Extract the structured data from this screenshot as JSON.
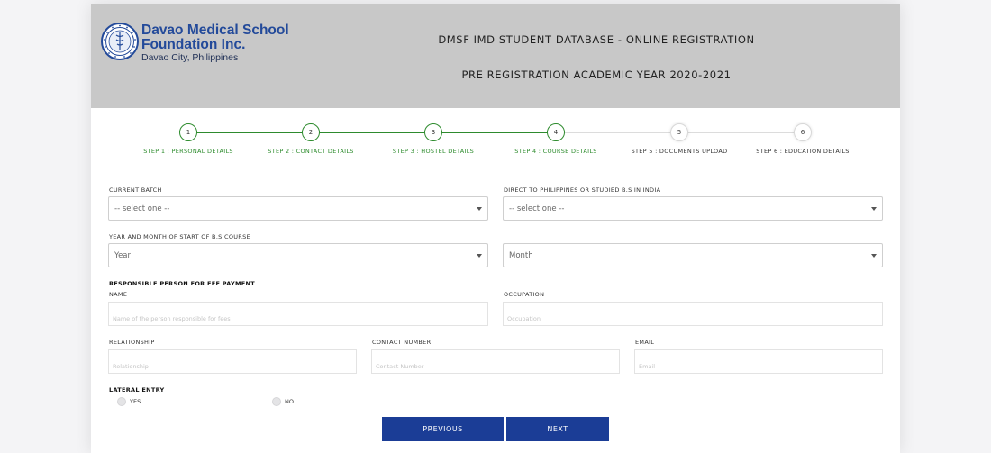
{
  "header": {
    "logo_line1": "Davao Medical School",
    "logo_line2": "Foundation Inc.",
    "logo_line3": "Davao City, Philippines",
    "title": "DMSF IMD STUDENT DATABASE - ONLINE REGISTRATION",
    "subtitle": "PRE REGISTRATION ACADEMIC YEAR 2020-2021"
  },
  "steps": [
    {
      "number": "1",
      "label": "STEP 1 : PERSONAL DETAILS",
      "state": "done"
    },
    {
      "number": "2",
      "label": "STEP 2 : CONTACT DETAILS",
      "state": "done"
    },
    {
      "number": "3",
      "label": "STEP 3 : HOSTEL DETAILS",
      "state": "done"
    },
    {
      "number": "4",
      "label": "STEP 4 : COURSE DETAILS",
      "state": "current"
    },
    {
      "number": "5",
      "label": "STEP 5 : DOCUMENTS UPLOAD",
      "state": "pending"
    },
    {
      "number": "6",
      "label": "STEP 6 : EDUCATION DETAILS",
      "state": "pending"
    }
  ],
  "form": {
    "current_batch_label": "CURRENT BATCH",
    "current_batch_value": "-- select one --",
    "direct_label": "DIRECT TO PHILIPPINES OR STUDIED B.S IN INDIA",
    "direct_value": "-- select one --",
    "year_month_label": "YEAR AND MONTH OF START OF B.S COURSE",
    "year_value": "Year",
    "month_value": "Month",
    "responsible_heading": "RESPONSIBLE PERSON FOR FEE PAYMENT",
    "name_label": "NAME",
    "name_placeholder": "Name of the person responsible for fees",
    "occupation_label": "OCCUPATION",
    "occupation_placeholder": "Occupation",
    "relationship_label": "RELATIONSHIP",
    "relationship_placeholder": "Relationship",
    "contact_label": "CONTACT NUMBER",
    "contact_placeholder": "Contact Number",
    "email_label": "EMAIL",
    "email_placeholder": "Email",
    "lateral_label": "LATERAL ENTRY",
    "yes_label": "YES",
    "no_label": "NO"
  },
  "buttons": {
    "previous": "PREVIOUS",
    "next": "NEXT"
  },
  "colors": {
    "header_bg": "#c8c8c8",
    "brand_blue": "#234a9a",
    "step_green": "#2e8b2e",
    "button_blue": "#1b3d96"
  }
}
